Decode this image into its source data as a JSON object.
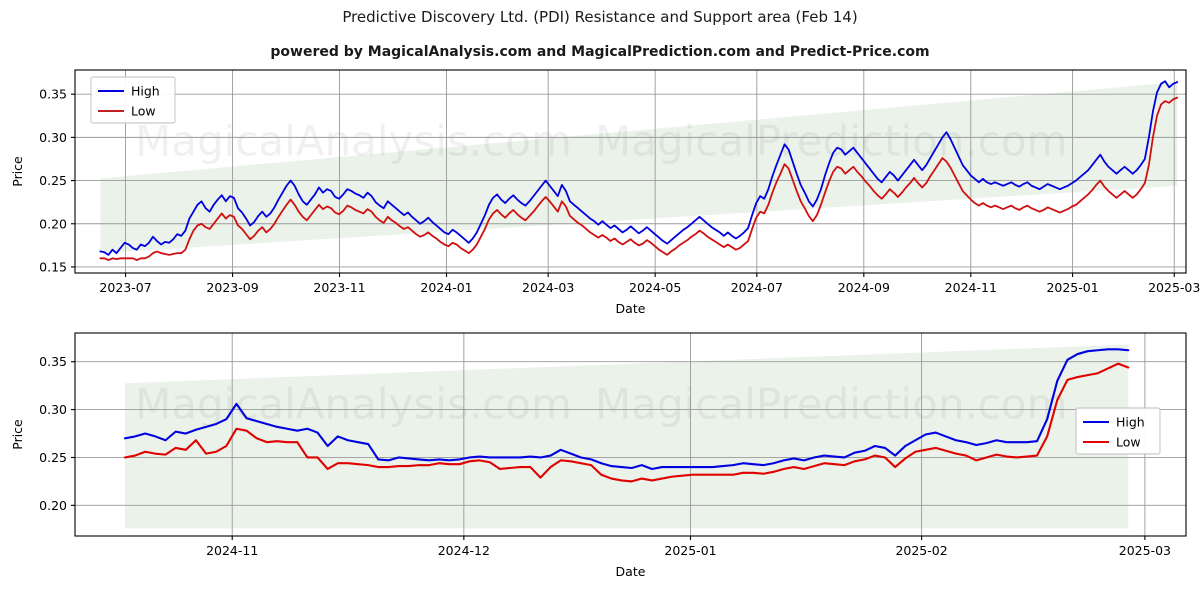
{
  "header": {
    "title": "Predictive Discovery Ltd. (PDI) Resistance and Support area (Feb 14)",
    "subtitle": "powered by MagicalAnalysis.com and MagicalPrediction.com and Predict-Price.com"
  },
  "watermarks": {
    "row1_left": "MagicalAnalysis.com",
    "row1_right": "MagicalPrediction.com",
    "row2_left": "MagicalAnalysis.com",
    "row2_right": "MagicalPrediction.com"
  },
  "legend": {
    "high_label": "High",
    "low_label": "Low",
    "high_color": "#0000e0",
    "low_color": "#c02020"
  },
  "chart_data": [
    {
      "id": "top-chart",
      "type": "line",
      "title": "Predictive Discovery Ltd. (PDI) Resistance and Support area (Feb 14)",
      "xlabel": "Date",
      "ylabel": "Price",
      "grid": true,
      "legend_position": "upper-left",
      "ylim": [
        0.143,
        0.378
      ],
      "yticks": [
        0.15,
        0.2,
        0.25,
        0.3,
        0.35
      ],
      "ytick_labels": [
        "0.15",
        "0.20",
        "0.25",
        "0.30",
        "0.35"
      ],
      "xlim": [
        "2023-06-08",
        "2025-03-22"
      ],
      "xticks": [
        "2023-07",
        "2023-09",
        "2023-11",
        "2024-01",
        "2024-03",
        "2024-05",
        "2024-07",
        "2024-09",
        "2024-11",
        "2025-01",
        "2025-03"
      ],
      "xtick_positions": [
        0.0455,
        0.1418,
        0.2381,
        0.3344,
        0.4259,
        0.5222,
        0.6137,
        0.71,
        0.8063,
        0.8979,
        0.9894
      ],
      "band": {
        "name": "resistance-support-area",
        "color": "#2e7d32",
        "opacity": 0.1,
        "x_start_frac": 0.0228,
        "x_end_frac": 0.9921,
        "upper_start": 0.2525,
        "upper_end": 0.364,
        "lower_start": 0.166,
        "lower_end": 0.244
      },
      "series": [
        {
          "name": "High",
          "color": "#0000e0",
          "values": [
            0.168,
            0.167,
            0.164,
            0.17,
            0.166,
            0.172,
            0.178,
            0.176,
            0.172,
            0.17,
            0.176,
            0.174,
            0.178,
            0.185,
            0.18,
            0.176,
            0.179,
            0.178,
            0.182,
            0.188,
            0.186,
            0.192,
            0.206,
            0.214,
            0.222,
            0.226,
            0.218,
            0.214,
            0.222,
            0.228,
            0.233,
            0.226,
            0.232,
            0.23,
            0.218,
            0.213,
            0.206,
            0.198,
            0.202,
            0.209,
            0.214,
            0.208,
            0.212,
            0.219,
            0.228,
            0.236,
            0.244,
            0.25,
            0.244,
            0.234,
            0.226,
            0.222,
            0.228,
            0.234,
            0.242,
            0.236,
            0.24,
            0.238,
            0.231,
            0.229,
            0.234,
            0.24,
            0.238,
            0.235,
            0.233,
            0.23,
            0.236,
            0.232,
            0.225,
            0.221,
            0.218,
            0.226,
            0.222,
            0.218,
            0.214,
            0.21,
            0.213,
            0.208,
            0.204,
            0.2,
            0.203,
            0.207,
            0.202,
            0.198,
            0.194,
            0.19,
            0.188,
            0.193,
            0.19,
            0.186,
            0.182,
            0.178,
            0.183,
            0.19,
            0.2,
            0.21,
            0.222,
            0.23,
            0.234,
            0.228,
            0.224,
            0.229,
            0.233,
            0.228,
            0.224,
            0.221,
            0.226,
            0.232,
            0.238,
            0.244,
            0.25,
            0.244,
            0.238,
            0.232,
            0.245,
            0.238,
            0.226,
            0.222,
            0.218,
            0.214,
            0.21,
            0.206,
            0.203,
            0.199,
            0.203,
            0.199,
            0.195,
            0.198,
            0.194,
            0.19,
            0.193,
            0.197,
            0.193,
            0.189,
            0.192,
            0.196,
            0.192,
            0.188,
            0.184,
            0.18,
            0.177,
            0.181,
            0.185,
            0.189,
            0.193,
            0.196,
            0.2,
            0.204,
            0.208,
            0.204,
            0.2,
            0.196,
            0.193,
            0.19,
            0.186,
            0.19,
            0.186,
            0.183,
            0.186,
            0.19,
            0.195,
            0.21,
            0.224,
            0.232,
            0.229,
            0.24,
            0.255,
            0.268,
            0.28,
            0.292,
            0.286,
            0.272,
            0.258,
            0.245,
            0.236,
            0.226,
            0.22,
            0.228,
            0.24,
            0.256,
            0.27,
            0.282,
            0.288,
            0.286,
            0.28,
            0.284,
            0.288,
            0.282,
            0.276,
            0.27,
            0.264,
            0.258,
            0.252,
            0.248,
            0.254,
            0.26,
            0.256,
            0.25,
            0.256,
            0.262,
            0.268,
            0.274,
            0.268,
            0.262,
            0.268,
            0.276,
            0.284,
            0.292,
            0.3,
            0.306,
            0.298,
            0.288,
            0.278,
            0.268,
            0.262,
            0.256,
            0.252,
            0.248,
            0.252,
            0.248,
            0.246,
            0.248,
            0.246,
            0.244,
            0.246,
            0.248,
            0.245,
            0.243,
            0.246,
            0.248,
            0.244,
            0.242,
            0.24,
            0.243,
            0.246,
            0.244,
            0.242,
            0.24,
            0.242,
            0.244,
            0.247,
            0.25,
            0.254,
            0.258,
            0.262,
            0.268,
            0.274,
            0.28,
            0.272,
            0.266,
            0.262,
            0.258,
            0.262,
            0.266,
            0.262,
            0.258,
            0.262,
            0.268,
            0.275,
            0.3,
            0.33,
            0.352,
            0.362,
            0.365,
            0.358,
            0.362,
            0.364
          ]
        },
        {
          "name": "Low",
          "color": "#c02020",
          "values": [
            0.16,
            0.16,
            0.158,
            0.16,
            0.159,
            0.16,
            0.16,
            0.16,
            0.16,
            0.158,
            0.16,
            0.16,
            0.162,
            0.166,
            0.168,
            0.166,
            0.165,
            0.164,
            0.165,
            0.166,
            0.166,
            0.17,
            0.182,
            0.192,
            0.198,
            0.2,
            0.196,
            0.194,
            0.2,
            0.206,
            0.212,
            0.206,
            0.21,
            0.208,
            0.198,
            0.194,
            0.188,
            0.182,
            0.186,
            0.192,
            0.196,
            0.19,
            0.194,
            0.2,
            0.208,
            0.215,
            0.222,
            0.228,
            0.222,
            0.214,
            0.208,
            0.204,
            0.21,
            0.216,
            0.222,
            0.217,
            0.22,
            0.218,
            0.213,
            0.211,
            0.215,
            0.221,
            0.219,
            0.216,
            0.214,
            0.212,
            0.217,
            0.214,
            0.208,
            0.204,
            0.201,
            0.208,
            0.204,
            0.201,
            0.197,
            0.194,
            0.196,
            0.192,
            0.188,
            0.185,
            0.187,
            0.19,
            0.186,
            0.183,
            0.179,
            0.176,
            0.174,
            0.178,
            0.176,
            0.172,
            0.169,
            0.166,
            0.17,
            0.176,
            0.185,
            0.194,
            0.205,
            0.212,
            0.216,
            0.211,
            0.207,
            0.212,
            0.216,
            0.211,
            0.207,
            0.204,
            0.209,
            0.214,
            0.22,
            0.226,
            0.231,
            0.226,
            0.22,
            0.214,
            0.226,
            0.22,
            0.209,
            0.205,
            0.201,
            0.198,
            0.194,
            0.19,
            0.187,
            0.184,
            0.187,
            0.184,
            0.18,
            0.183,
            0.179,
            0.176,
            0.179,
            0.182,
            0.178,
            0.175,
            0.177,
            0.181,
            0.178,
            0.174,
            0.17,
            0.167,
            0.164,
            0.168,
            0.171,
            0.175,
            0.178,
            0.181,
            0.185,
            0.188,
            0.192,
            0.189,
            0.185,
            0.182,
            0.179,
            0.176,
            0.173,
            0.176,
            0.173,
            0.17,
            0.172,
            0.176,
            0.18,
            0.194,
            0.207,
            0.214,
            0.212,
            0.222,
            0.236,
            0.248,
            0.258,
            0.269,
            0.264,
            0.251,
            0.238,
            0.226,
            0.218,
            0.209,
            0.203,
            0.21,
            0.222,
            0.236,
            0.249,
            0.26,
            0.266,
            0.264,
            0.258,
            0.262,
            0.266,
            0.26,
            0.255,
            0.249,
            0.244,
            0.238,
            0.233,
            0.229,
            0.234,
            0.24,
            0.236,
            0.231,
            0.236,
            0.242,
            0.247,
            0.253,
            0.247,
            0.242,
            0.247,
            0.255,
            0.262,
            0.269,
            0.276,
            0.272,
            0.265,
            0.256,
            0.247,
            0.238,
            0.233,
            0.228,
            0.224,
            0.221,
            0.224,
            0.221,
            0.219,
            0.221,
            0.219,
            0.217,
            0.219,
            0.221,
            0.218,
            0.216,
            0.219,
            0.221,
            0.218,
            0.216,
            0.214,
            0.216,
            0.219,
            0.217,
            0.215,
            0.213,
            0.215,
            0.217,
            0.22,
            0.222,
            0.226,
            0.23,
            0.234,
            0.239,
            0.245,
            0.25,
            0.243,
            0.238,
            0.234,
            0.23,
            0.234,
            0.238,
            0.234,
            0.23,
            0.234,
            0.24,
            0.247,
            0.268,
            0.3,
            0.325,
            0.338,
            0.342,
            0.34,
            0.344,
            0.346
          ]
        }
      ]
    },
    {
      "id": "bottom-chart",
      "type": "line",
      "xlabel": "Date",
      "ylabel": "Price",
      "grid": true,
      "legend_position": "right",
      "ylim": [
        0.168,
        0.38
      ],
      "yticks": [
        0.2,
        0.25,
        0.3,
        0.35
      ],
      "ytick_labels": [
        "0.20",
        "0.25",
        "0.30",
        "0.35"
      ],
      "xlim": [
        "2024-10-10",
        "2025-03-10"
      ],
      "xticks": [
        "2024-11",
        "2024-12",
        "2025-01",
        "2025-02",
        "2025-03"
      ],
      "xtick_positions": [
        0.1415,
        0.35,
        0.554,
        0.762,
        0.963
      ],
      "band": {
        "name": "resistance-support-area",
        "color": "#2e7d32",
        "opacity": 0.1,
        "x_start_frac": 0.045,
        "x_end_frac": 0.948,
        "upper_start": 0.3275,
        "upper_end": 0.368,
        "lower_start": 0.176,
        "lower_end": 0.176
      },
      "series": [
        {
          "name": "High",
          "color": "#0000e0",
          "values": [
            0.27,
            0.272,
            0.275,
            0.272,
            0.268,
            0.277,
            0.275,
            0.279,
            0.282,
            0.285,
            0.29,
            0.306,
            0.291,
            0.288,
            0.285,
            0.282,
            0.28,
            0.278,
            0.28,
            0.276,
            0.262,
            0.272,
            0.268,
            0.266,
            0.264,
            0.248,
            0.247,
            0.25,
            0.249,
            0.248,
            0.247,
            0.248,
            0.247,
            0.248,
            0.25,
            0.251,
            0.25,
            0.25,
            0.25,
            0.25,
            0.251,
            0.25,
            0.252,
            0.258,
            0.254,
            0.25,
            0.248,
            0.244,
            0.241,
            0.24,
            0.239,
            0.242,
            0.238,
            0.24,
            0.24,
            0.24,
            0.24,
            0.24,
            0.24,
            0.241,
            0.242,
            0.244,
            0.243,
            0.242,
            0.244,
            0.247,
            0.249,
            0.247,
            0.25,
            0.252,
            0.251,
            0.25,
            0.255,
            0.257,
            0.262,
            0.26,
            0.252,
            0.262,
            0.268,
            0.274,
            0.276,
            0.272,
            0.268,
            0.266,
            0.263,
            0.265,
            0.268,
            0.266,
            0.266,
            0.266,
            0.267,
            0.29,
            0.33,
            0.352,
            0.358,
            0.361,
            0.362,
            0.363,
            0.363,
            0.362
          ]
        },
        {
          "name": "Low",
          "color": "#e00000",
          "values": [
            0.25,
            0.252,
            0.256,
            0.254,
            0.253,
            0.26,
            0.258,
            0.268,
            0.254,
            0.256,
            0.262,
            0.28,
            0.278,
            0.27,
            0.266,
            0.267,
            0.266,
            0.266,
            0.25,
            0.25,
            0.238,
            0.244,
            0.244,
            0.243,
            0.242,
            0.24,
            0.24,
            0.241,
            0.241,
            0.242,
            0.242,
            0.244,
            0.243,
            0.243,
            0.246,
            0.247,
            0.245,
            0.238,
            0.239,
            0.24,
            0.24,
            0.229,
            0.24,
            0.247,
            0.246,
            0.244,
            0.242,
            0.232,
            0.228,
            0.226,
            0.225,
            0.228,
            0.226,
            0.228,
            0.23,
            0.231,
            0.232,
            0.232,
            0.232,
            0.232,
            0.232,
            0.234,
            0.234,
            0.233,
            0.235,
            0.238,
            0.24,
            0.238,
            0.241,
            0.244,
            0.243,
            0.242,
            0.246,
            0.248,
            0.252,
            0.25,
            0.24,
            0.249,
            0.256,
            0.258,
            0.26,
            0.257,
            0.254,
            0.252,
            0.247,
            0.25,
            0.253,
            0.251,
            0.25,
            0.251,
            0.252,
            0.272,
            0.31,
            0.331,
            0.334,
            0.336,
            0.338,
            0.343,
            0.348,
            0.344
          ]
        }
      ]
    }
  ]
}
